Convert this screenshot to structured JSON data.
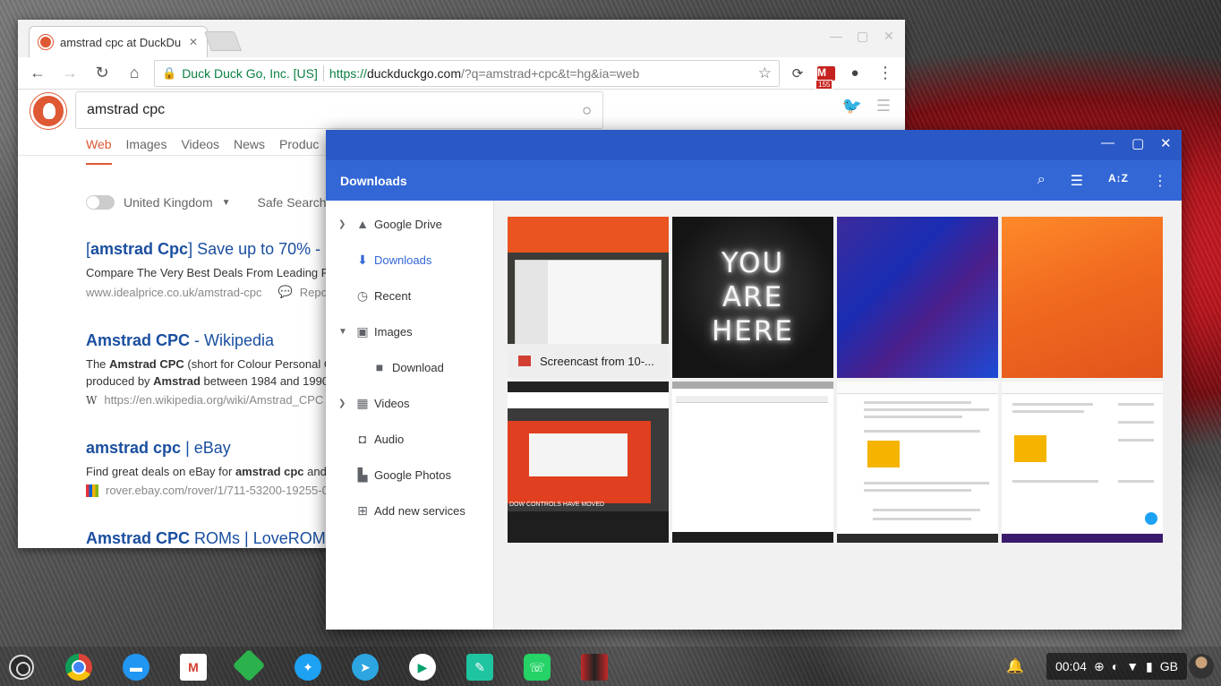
{
  "browser": {
    "tab_title": "amstrad cpc at DuckDu",
    "site_identity": "Duck Duck Go, Inc. [US]",
    "url_scheme": "https://",
    "url_host": "duckduckgo.com",
    "url_rest": "/?q=amstrad+cpc&t=hg&ia=web",
    "gmail_badge": "155"
  },
  "ddg": {
    "query": "amstrad cpc",
    "tabs": [
      "Web",
      "Images",
      "Videos",
      "News",
      "Produc"
    ],
    "region": "United Kingdom",
    "safe_search": "Safe Search: S",
    "results": [
      {
        "title_pre": "[",
        "title_bold": "amstrad Cpc",
        "title_post": "] Save up to 70% - F",
        "snippet": "Compare The Very Best Deals From Leading R",
        "url": "www.idealprice.co.uk/amstrad-cpc",
        "extra": "Repor"
      },
      {
        "title_pre": "",
        "title_bold": "Amstrad CPC",
        "title_post": " - Wikipedia",
        "snippet_1_pre": "The ",
        "snippet_1_bold": "Amstrad CPC",
        "snippet_1_post": " (short for Colour Personal C",
        "snippet_2_pre": "produced by ",
        "snippet_2_bold": "Amstrad",
        "snippet_2_post": " between 1984 and 1990",
        "url_icon": "W",
        "url": "https://en.wikipedia.org/wiki/Amstrad_CPC"
      },
      {
        "title_pre": "",
        "title_bold": "amstrad cpc",
        "title_post": " | eBay",
        "snippet_pre": "Find great deals on eBay for ",
        "snippet_bold": "amstrad cpc",
        "snippet_post": " and",
        "url": "rover.ebay.com/rover/1/711-53200-19255-0/"
      },
      {
        "title_pre": "",
        "title_bold": "Amstrad CPC",
        "title_post": " ROMs | LoveROMs"
      }
    ]
  },
  "files": {
    "title": "Downloads",
    "nav": [
      {
        "label": "Google Drive"
      },
      {
        "label": "Downloads"
      },
      {
        "label": "Recent"
      },
      {
        "label": "Images"
      },
      {
        "label": "Download"
      },
      {
        "label": "Videos"
      },
      {
        "label": "Audio"
      },
      {
        "label": "Google Photos"
      },
      {
        "label": "Add new services"
      }
    ],
    "thumb_label": "Screencast from 10-...",
    "neon_lines": [
      "YOU",
      "ARE",
      "HERE"
    ],
    "video_caption": "DOW CONTROLS HAVE MOVED"
  },
  "shelf": {
    "time": "00:04",
    "keyboard": "GB",
    "apps": [
      "chrome-icon",
      "files-icon",
      "gmail-icon",
      "feedly-icon",
      "twitter-icon",
      "telegram-icon",
      "play-store-icon",
      "text-editor-icon",
      "whatsapp-icon",
      "game-icon"
    ]
  },
  "colors": {
    "ddg_orange": "#de5833",
    "files_blue": "#3367d6",
    "link_blue": "#1a4fa0"
  }
}
